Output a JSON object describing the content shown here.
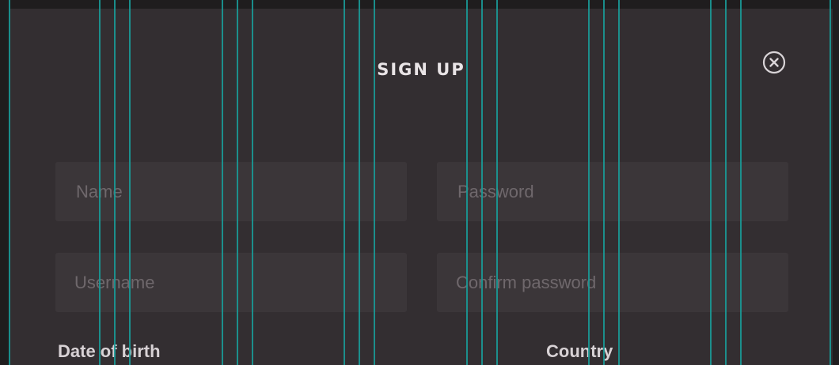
{
  "modal": {
    "title": "SIGN UP",
    "close_icon": "close-circle-icon"
  },
  "form": {
    "name_placeholder": "Name",
    "password_placeholder": "Password",
    "username_placeholder": "Username",
    "confirm_password_placeholder": "Confirm password",
    "date_of_birth_label": "Date of birth",
    "country_label": "Country"
  },
  "colors": {
    "background": "#1f1d1e",
    "modal": "#332e31",
    "field": "#3b3639",
    "placeholder": "#6f686c",
    "guide_lines": "#1a9a97"
  }
}
